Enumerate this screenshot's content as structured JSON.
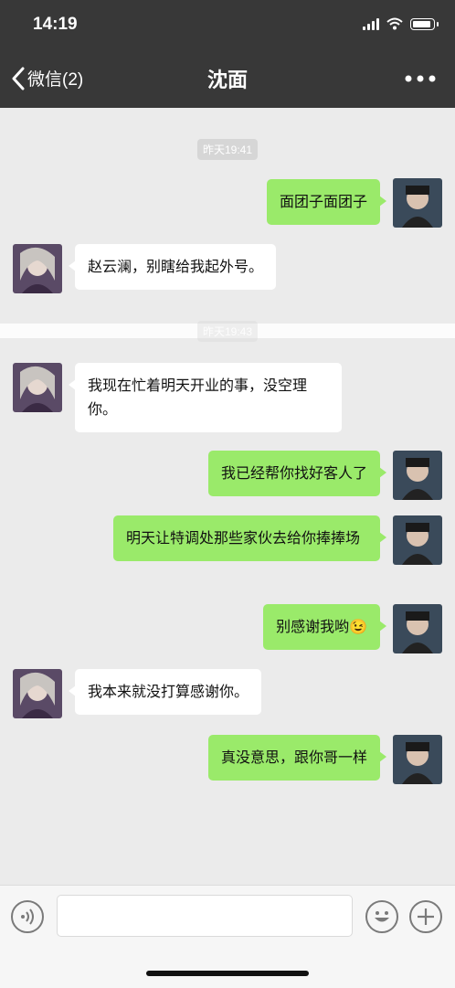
{
  "status_bar": {
    "time": "14:19"
  },
  "nav": {
    "back_label": "微信(2)",
    "title": "沈面"
  },
  "timestamps": [
    "昨天19:41",
    "昨天19:43"
  ],
  "messages": [
    {
      "from": "me",
      "text": "面团子面团子"
    },
    {
      "from": "them",
      "text": "赵云澜，别瞎给我起外号。"
    },
    {
      "from": "them",
      "text": "我现在忙着明天开业的事，没空理你。"
    },
    {
      "from": "me",
      "text": "我已经帮你找好客人了"
    },
    {
      "from": "me",
      "text": "明天让特调处那些家伙去给你捧捧场"
    },
    {
      "from": "me",
      "text": "别感谢我哟",
      "emoji": "😉"
    },
    {
      "from": "them",
      "text": "我本来就没打算感谢你。"
    },
    {
      "from": "me",
      "text": "真没意思，跟你哥一样"
    }
  ],
  "input_bar": {
    "voice_icon": "voice-icon",
    "emoji_icon": "smiley-icon",
    "add_icon": "plus-icon",
    "text_value": ""
  },
  "colors": {
    "nav_bg": "#383838",
    "chat_bg": "#ebebeb",
    "my_bubble": "#9aea6a",
    "their_bubble": "#ffffff"
  }
}
